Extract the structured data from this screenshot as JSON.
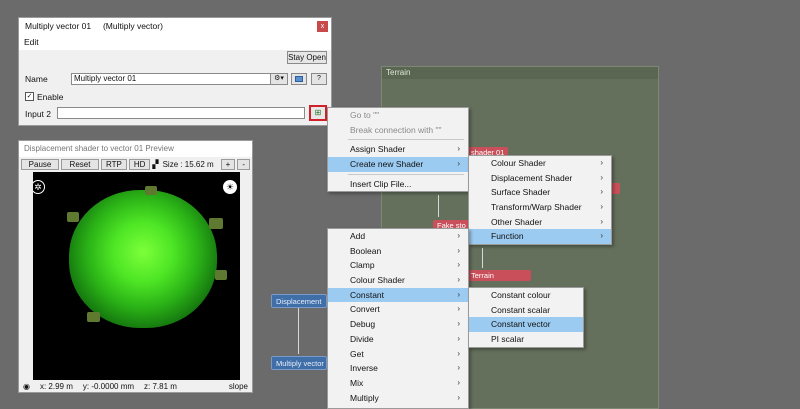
{
  "graph": {
    "panel_title": "Terrain",
    "nodes": {
      "shader01": "shader 01",
      "fake": "Fake sto",
      "terrain": "Terrain",
      "displacement": "Displacement",
      "multiply": "Multiply vector"
    }
  },
  "dialog": {
    "title": "Multiply vector 01     (Multiply vector)",
    "close_glyph": "x",
    "menu_edit": "Edit",
    "stay_open": "Stay Open",
    "name_label": "Name",
    "name_value": "Multiply vector 01",
    "enable_label": "Enable",
    "enable_check": "✓",
    "input2_label": "Input 2",
    "gear_glyph": "⚙▾",
    "help_glyph": "?",
    "add_glyph": "⊞"
  },
  "preview": {
    "title": "Displacement shader to vector 01 Preview",
    "pause": "Pause",
    "reset": "Reset",
    "rtp": "RTP",
    "hd": "HD",
    "size": "Size : 15.62 m",
    "plus": "+",
    "minus": "-",
    "status_x": "x: 2.99 m",
    "status_y": "y: -0.0000 mm",
    "status_z": "z: 7.81 m",
    "status_slope": "slope"
  },
  "menu1": {
    "items": [
      {
        "label": "Go to \"\"",
        "disabled": true
      },
      {
        "label": "Break connection with \"\"",
        "disabled": true
      },
      {
        "label": "Assign Shader",
        "arrow": true
      },
      {
        "label": "Create new Shader",
        "arrow": true,
        "active": true
      },
      {
        "label": "Insert Clip File..."
      }
    ]
  },
  "menu2": {
    "items": [
      {
        "label": "Colour Shader",
        "arrow": true
      },
      {
        "label": "Displacement Shader",
        "arrow": true
      },
      {
        "label": "Surface Shader",
        "arrow": true
      },
      {
        "label": "Transform/Warp Shader",
        "arrow": true
      },
      {
        "label": "Other Shader",
        "arrow": true
      },
      {
        "label": "Function",
        "arrow": true,
        "active": true
      }
    ]
  },
  "menu3": {
    "items": [
      {
        "label": "Add",
        "arrow": true
      },
      {
        "label": "Boolean",
        "arrow": true
      },
      {
        "label": "Clamp",
        "arrow": true
      },
      {
        "label": "Colour Shader",
        "arrow": true
      },
      {
        "label": "Constant",
        "arrow": true,
        "active": true
      },
      {
        "label": "Convert",
        "arrow": true
      },
      {
        "label": "Debug",
        "arrow": true
      },
      {
        "label": "Divide",
        "arrow": true
      },
      {
        "label": "Get",
        "arrow": true
      },
      {
        "label": "Inverse",
        "arrow": true
      },
      {
        "label": "Mix",
        "arrow": true
      },
      {
        "label": "Multiply",
        "arrow": true
      }
    ]
  },
  "menu4": {
    "items": [
      {
        "label": "Constant colour"
      },
      {
        "label": "Constant scalar"
      },
      {
        "label": "Constant vector",
        "active": true
      },
      {
        "label": "PI scalar"
      }
    ]
  },
  "arrow_glyph": "›"
}
